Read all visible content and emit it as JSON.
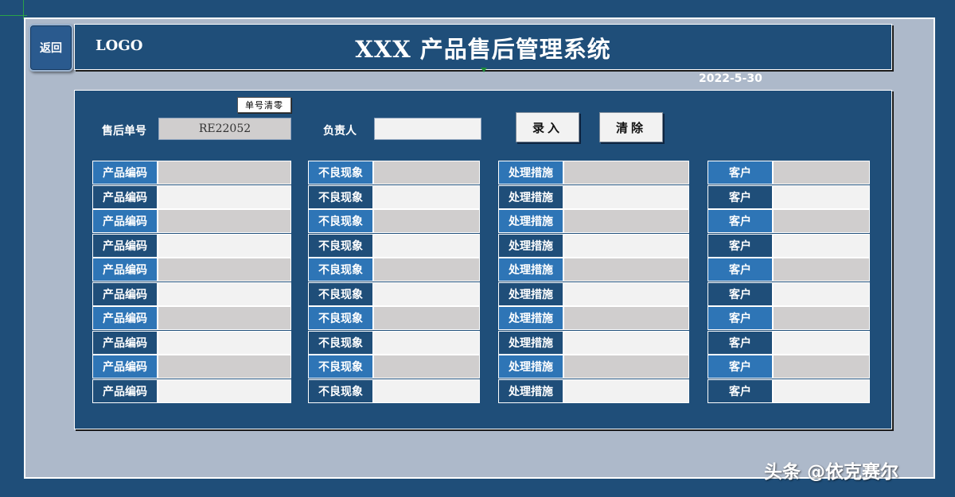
{
  "header": {
    "back_label": "返回",
    "logo_text": "LOGO",
    "title": "XXX 产品售后管理系统",
    "date": "2022-5-30"
  },
  "form": {
    "reset_label": "单号清零",
    "order_no_label": "售后单号",
    "order_no_value": "RE22052",
    "owner_label": "负责人",
    "owner_value": "",
    "submit_label": "录入",
    "clear_label": "清除"
  },
  "grid": {
    "columns": [
      {
        "label": "产品编码"
      },
      {
        "label": "不良现象"
      },
      {
        "label": "处理措施"
      },
      {
        "label": "客户"
      }
    ],
    "row_count": 10
  },
  "watermark": "头条 @依克赛尔",
  "colors": {
    "background": "#1f4e79",
    "frame": "#adb9ca",
    "label_light": "#2e75b6",
    "label_dark": "#1f4e79",
    "input_gray": "#d0cece",
    "input_light": "#f2f2f2"
  }
}
